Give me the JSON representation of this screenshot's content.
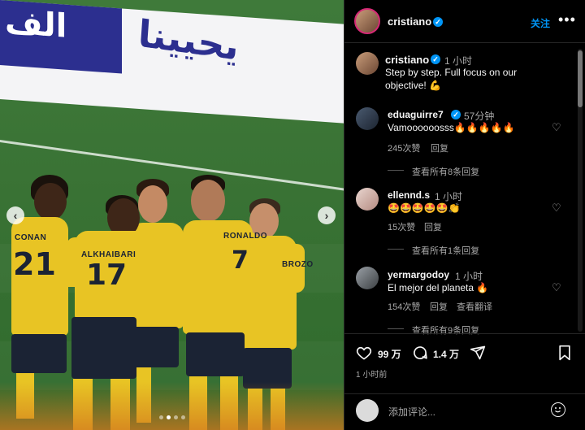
{
  "media": {
    "board_text_left": "الف",
    "board_text_right": "يحيينا",
    "players": [
      {
        "name": "CONAN",
        "number": "21"
      },
      {
        "name": "ALKHAIBARI",
        "number": "17"
      },
      {
        "name": "RONALDO",
        "number": "7"
      },
      {
        "name": "BROZO",
        "number": ""
      }
    ],
    "prev_icon": "chevron-left-icon",
    "next_icon": "chevron-right-icon",
    "carousel_total": 4,
    "carousel_active": 1
  },
  "header": {
    "username": "cristiano",
    "verified": true,
    "follow_label": "关注",
    "more_icon": "more-horizontal-icon"
  },
  "caption": {
    "username": "cristiano",
    "time": "1 小时",
    "text": "Step by step. Full focus on our objective! 💪"
  },
  "comments": [
    {
      "username": "eduaguirre7",
      "verified": true,
      "time": "57分钟",
      "text": "Vamoooooosss🔥🔥🔥🔥🔥",
      "likes": "245次赞",
      "reply_label": "回复",
      "translate_label": "",
      "view_replies": "查看所有8条回复"
    },
    {
      "username": "ellennd.s",
      "verified": false,
      "time": "1 小时",
      "text": "🤩🤩🤩🤩🤩👏",
      "likes": "15次赞",
      "reply_label": "回复",
      "translate_label": "",
      "view_replies": "查看所有1条回复"
    },
    {
      "username": "yermargodoy",
      "verified": false,
      "time": "1 小时",
      "text": "El mejor del planeta 🔥",
      "likes": "154次赞",
      "reply_label": "回复",
      "translate_label": "查看翻译",
      "view_replies": "查看所有9条回复"
    }
  ],
  "actions": {
    "like_count": "99 万",
    "comment_count": "1.4 万",
    "posted_time": "1 小时前"
  },
  "composer": {
    "placeholder": "添加评论..."
  },
  "colors": {
    "accent": "#0095f6",
    "jersey": "#e8c424",
    "shorts": "#1b2334",
    "background": "#000000"
  }
}
